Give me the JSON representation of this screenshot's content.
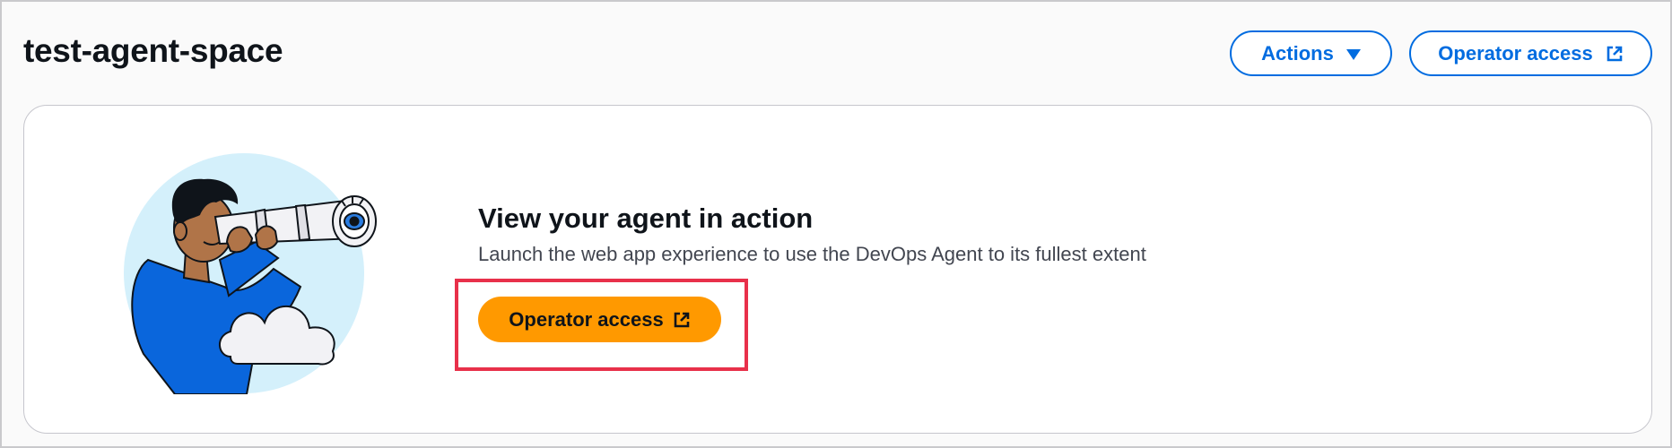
{
  "page": {
    "title": "test-agent-space"
  },
  "header": {
    "actions_label": "Actions",
    "operator_access_label": "Operator access"
  },
  "card": {
    "title": "View your agent in action",
    "subtitle": "Launch the web app experience to use the DevOps Agent to its fullest extent",
    "button_label": "Operator access"
  },
  "icons": {
    "actions_caret": "caret-down-icon",
    "external_link": "external-link-icon",
    "illustration": "person-with-telescope-illustration"
  },
  "colors": {
    "primary_button": "#ff9900",
    "secondary_button_border": "#006ce0",
    "highlight": "#e8304a",
    "illustration_bg": "#d4f0fb",
    "shirt": "#0a66dc"
  }
}
